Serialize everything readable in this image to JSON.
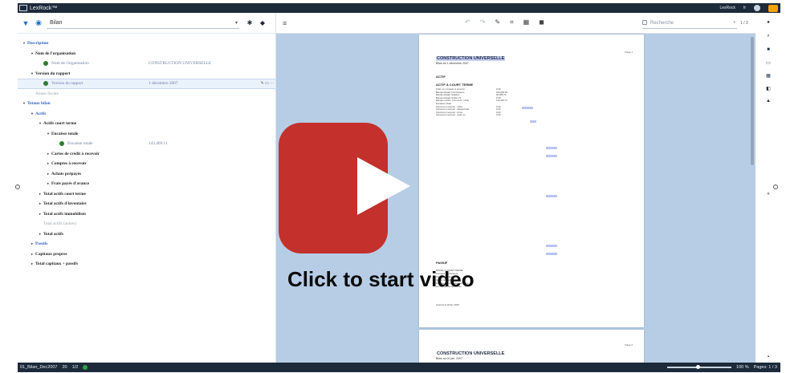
{
  "app": {
    "title": "LexRock™",
    "brand": "LexRock",
    "lang": "fr"
  },
  "left_toolbar": {
    "select_value": "Bilan"
  },
  "tree": [
    {
      "label": "Description",
      "style": "blue",
      "indent": 0,
      "arrow": "▾"
    },
    {
      "label": "Nom de l'organisation",
      "style": "bold",
      "indent": 1,
      "arrow": "▾"
    },
    {
      "label": "Nom de l'organisation",
      "style": "leaf",
      "indent": 2,
      "arrow": "",
      "dot": true,
      "value": "CONSTRUCTION UNIVERSELLE"
    },
    {
      "label": "Version du rapport",
      "style": "bold",
      "indent": 1,
      "arrow": "▾"
    },
    {
      "label": "Version du rapport",
      "style": "leaf",
      "indent": 2,
      "arrow": "",
      "dot": true,
      "value": "1 décembre 2007",
      "selected": true
    },
    {
      "label": "Année fiscale",
      "style": "gray",
      "indent": 1,
      "arrow": ""
    },
    {
      "label": "Totaux bilan",
      "style": "blue",
      "indent": 0,
      "arrow": "▾"
    },
    {
      "label": "Actifs",
      "style": "blue",
      "indent": 1,
      "arrow": "▾"
    },
    {
      "label": "Actifs court terme",
      "style": "bold",
      "indent": 2,
      "arrow": "▾"
    },
    {
      "label": "Encaisse totale",
      "style": "bold",
      "indent": 3,
      "arrow": "▾"
    },
    {
      "label": "Encaisse totale",
      "style": "leaf",
      "indent": 4,
      "arrow": "",
      "dot": true,
      "value": "143,409.11"
    },
    {
      "label": "Cartes de crédit à recevoir",
      "style": "bold",
      "indent": 3,
      "arrow": "▸"
    },
    {
      "label": "Comptes à recevoir",
      "style": "bold",
      "indent": 3,
      "arrow": "▸"
    },
    {
      "label": "Achats prépayés",
      "style": "bold",
      "indent": 3,
      "arrow": "▸"
    },
    {
      "label": "Frais payés d'avance",
      "style": "bold",
      "indent": 3,
      "arrow": "▸"
    },
    {
      "label": "Total actifs court terme",
      "style": "bold",
      "indent": 2,
      "arrow": "▸"
    },
    {
      "label": "Total actifs d'inventaire",
      "style": "bold",
      "indent": 2,
      "arrow": "▸"
    },
    {
      "label": "Total actifs immobilisés",
      "style": "bold",
      "indent": 2,
      "arrow": "▸"
    },
    {
      "label": "Total actifs (autres)",
      "style": "gray",
      "indent": 2,
      "arrow": ""
    },
    {
      "label": "Total actifs",
      "style": "bold",
      "indent": 2,
      "arrow": "▸"
    },
    {
      "label": "Passifs",
      "style": "blue",
      "indent": 1,
      "arrow": "▸"
    },
    {
      "label": "Capitaux propres",
      "style": "bold",
      "indent": 1,
      "arrow": "▸"
    },
    {
      "label": "Total capitaux + passifs",
      "style": "bold",
      "indent": 1,
      "arrow": "▸"
    }
  ],
  "doc_toolbar": {
    "search_placeholder": "Recherche",
    "pager": "1 / 3"
  },
  "page1": {
    "number": "Page 1",
    "title": "CONSTRUCTION UNIVERSELLE",
    "subtitle": "Bilan au 1 décembre 2007",
    "section_actif": "ACTIF",
    "subsection": "ACTIF À COURT TERME",
    "lines": [
      "Total, au comptant à recevoir",
      "Banque Régal, Fournisseurs",
      "Banque Régal, Salaires",
      "Banque Régal, Dollar US",
      "Banque Cercle, Commerc., Unite",
      "Encaisse totale",
      "Sommes à recevoir - VISA",
      "Sommes à recevoir - MasterCard",
      "Sommes à recevoir - Amex",
      "Sommes à recevoir - autre ex"
    ],
    "line_values": [
      "0.00",
      "100,000.00",
      "25,488.74",
      "0.00",
      "112,000.71",
      "",
      "0.00",
      "0.00",
      "0.00",
      "0.00"
    ],
    "section_passif": "PASSIF",
    "passif_lines": [
      "PASSIF À COURT TERME",
      "Comptes fournisseurs",
      "Sommes à payer",
      "Cartes de crédit à payer",
      "Frais courus et autres provisions",
      "Les dépôts sur les ventes"
    ],
    "printed": "Imprimé le 18 fév. 2007"
  },
  "page2": {
    "number": "Page 2",
    "title": "CONSTRUCTION UNIVERSELLE",
    "subtitle": "Bilan au 01 jan. 2007"
  },
  "statusbar": {
    "file": "01_Bilan_Dec2007",
    "count": "20",
    "pages_short": "1/2",
    "zoom": "100 %",
    "pages": "Pages: 1 / 3"
  },
  "overlay": {
    "cta": "Click to start video"
  }
}
